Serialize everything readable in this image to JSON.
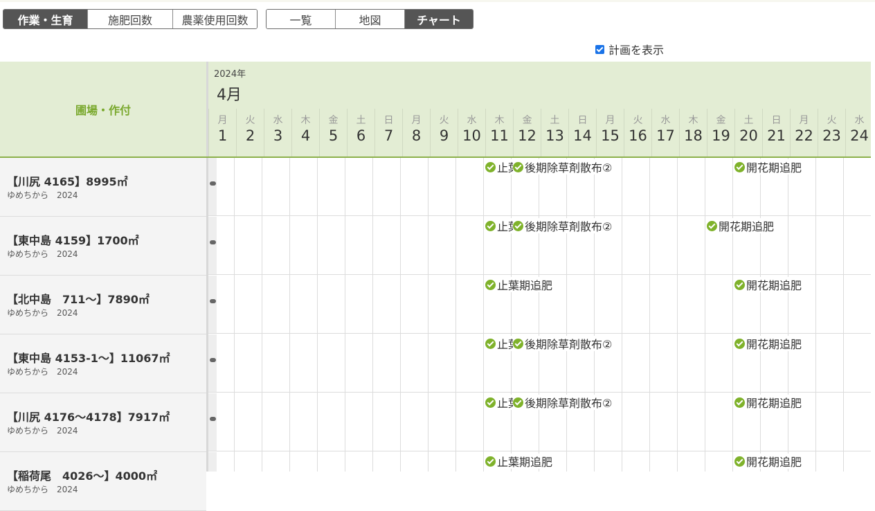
{
  "toolbar": {
    "view_tabs": [
      {
        "label": "作業・生育",
        "active": true
      },
      {
        "label": "施肥回数",
        "active": false
      },
      {
        "label": "農薬使用回数",
        "active": false
      }
    ],
    "mode_tabs": [
      {
        "label": "一覧",
        "active": false
      },
      {
        "label": "地図",
        "active": false
      },
      {
        "label": "チャート",
        "active": true
      }
    ],
    "show_plan_label": "計画を表示",
    "show_plan_checked": true
  },
  "header": {
    "left_label": "圃場・作付",
    "year": "2024年",
    "month": "4月",
    "days": [
      {
        "dow": "月",
        "num": "1"
      },
      {
        "dow": "火",
        "num": "2"
      },
      {
        "dow": "水",
        "num": "3"
      },
      {
        "dow": "木",
        "num": "4"
      },
      {
        "dow": "金",
        "num": "5"
      },
      {
        "dow": "土",
        "num": "6"
      },
      {
        "dow": "日",
        "num": "7"
      },
      {
        "dow": "月",
        "num": "8"
      },
      {
        "dow": "火",
        "num": "9"
      },
      {
        "dow": "水",
        "num": "10"
      },
      {
        "dow": "木",
        "num": "11"
      },
      {
        "dow": "金",
        "num": "12"
      },
      {
        "dow": "土",
        "num": "13"
      },
      {
        "dow": "日",
        "num": "14"
      },
      {
        "dow": "月",
        "num": "15"
      },
      {
        "dow": "火",
        "num": "16"
      },
      {
        "dow": "水",
        "num": "17"
      },
      {
        "dow": "木",
        "num": "18"
      },
      {
        "dow": "金",
        "num": "19"
      },
      {
        "dow": "土",
        "num": "20"
      },
      {
        "dow": "日",
        "num": "21"
      },
      {
        "dow": "月",
        "num": "22"
      },
      {
        "dow": "火",
        "num": "23"
      },
      {
        "dow": "水",
        "num": "24"
      }
    ]
  },
  "rows": [
    {
      "field": "【川尻 4165】8995㎡",
      "crop": "ゆめちから　2024",
      "events": [
        {
          "label": "止葉期追肥",
          "day": 11,
          "clip": true
        },
        {
          "label": "後期除草剤散布②",
          "day": 12
        },
        {
          "label": "開花期追肥",
          "day": 20
        }
      ]
    },
    {
      "field": "【東中島 4159】1700㎡",
      "crop": "ゆめちから　2024",
      "events": [
        {
          "label": "止葉期追肥",
          "day": 11,
          "clip": true
        },
        {
          "label": "後期除草剤散布②",
          "day": 12
        },
        {
          "label": "開花期追肥",
          "day": 19
        }
      ]
    },
    {
      "field": "【北中島　711～】7890㎡",
      "crop": "ゆめちから　2024",
      "events": [
        {
          "label": "止葉期追肥",
          "day": 11
        },
        {
          "label": "開花期追肥",
          "day": 20
        }
      ]
    },
    {
      "field": "【東中島 4153-1～】11067㎡",
      "crop": "ゆめちから　2024",
      "events": [
        {
          "label": "止葉期追肥",
          "day": 11,
          "clip": true
        },
        {
          "label": "後期除草剤散布②",
          "day": 12
        },
        {
          "label": "開花期追肥",
          "day": 20
        }
      ]
    },
    {
      "field": "【川尻 4176～4178】7917㎡",
      "crop": "ゆめちから　2024",
      "events": [
        {
          "label": "止葉期追肥",
          "day": 11,
          "clip": true
        },
        {
          "label": "後期除草剤散布②",
          "day": 12
        },
        {
          "label": "開花期追肥",
          "day": 20
        }
      ]
    },
    {
      "field": "【稲荷尾　4026～】4000㎡",
      "crop": "ゆめちから　2024",
      "events": [
        {
          "label": "止葉期追肥",
          "day": 11
        },
        {
          "label": "開花期追肥",
          "day": 20
        }
      ]
    }
  ],
  "colors": {
    "header_bg": "#e3edd4",
    "accent": "#79a82c",
    "check": "#7fb22b",
    "active_tab": "#555555"
  }
}
